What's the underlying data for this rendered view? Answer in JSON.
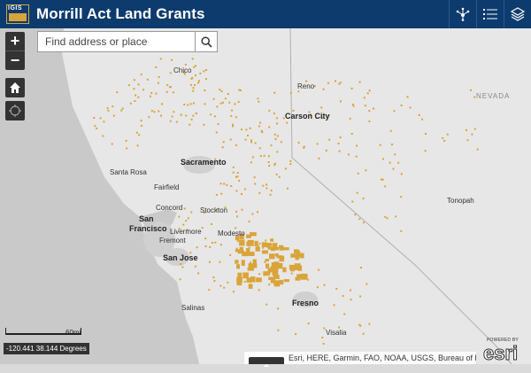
{
  "header": {
    "title": "Morrill Act Land Grants",
    "logo_text": "IGIS"
  },
  "header_buttons": [
    "share-icon",
    "legend-list-icon",
    "layers-icon"
  ],
  "search": {
    "placeholder": "Find address or place"
  },
  "map": {
    "grant_color": "#d9a43a",
    "labels": [
      {
        "text": "Chico"
      },
      {
        "text": "Reno"
      },
      {
        "text": "NEVADA"
      },
      {
        "text": "Carson City"
      },
      {
        "text": "Sacramento"
      },
      {
        "text": "Santa Rosa"
      },
      {
        "text": "Fairfield"
      },
      {
        "text": "Concord"
      },
      {
        "text": "Stockton"
      },
      {
        "text": "Livermore"
      },
      {
        "text": "San"
      },
      {
        "text": "Francisco"
      },
      {
        "text": "Fremont"
      },
      {
        "text": "Modesto"
      },
      {
        "text": "San Jose"
      },
      {
        "text": "Tonopah"
      },
      {
        "text": "Salinas"
      },
      {
        "text": "Fresno"
      },
      {
        "text": "Visalia"
      }
    ]
  },
  "scale": {
    "label": "60mi"
  },
  "coordinates": "-120.441 38.144 Degrees",
  "attribution": "Esri, HERE, Garmin, FAO, NOAA, USGS, Bureau of Land ...",
  "esri": {
    "powered": "POWERED BY",
    "brand": "esri"
  }
}
